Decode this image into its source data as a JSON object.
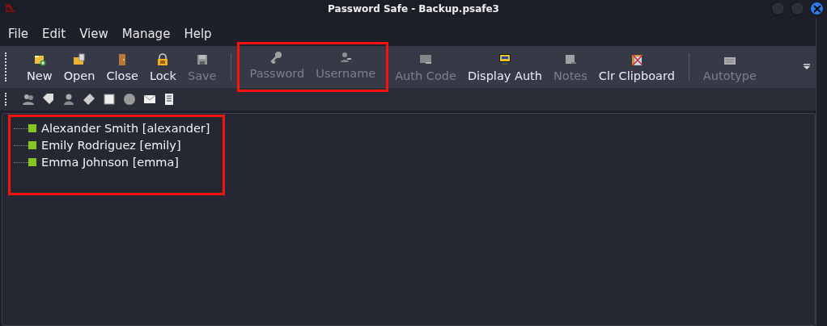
{
  "window": {
    "title": "Password Safe - Backup.psafe3"
  },
  "menu": [
    "File",
    "Edit",
    "View",
    "Manage",
    "Help"
  ],
  "toolbar": [
    {
      "highlighted": false,
      "separator_before": false,
      "buttons": [
        {
          "label": "New",
          "disabled": false
        },
        {
          "label": "Open",
          "disabled": false
        },
        {
          "label": "Close",
          "disabled": false
        },
        {
          "label": "Lock",
          "disabled": false
        },
        {
          "label": "Save",
          "disabled": true
        }
      ]
    },
    {
      "highlighted": true,
      "separator_before": true,
      "buttons": [
        {
          "label": "Password",
          "disabled": true
        },
        {
          "label": "Username",
          "disabled": true
        }
      ]
    },
    {
      "highlighted": false,
      "separator_before": false,
      "buttons": [
        {
          "label": "Auth Code",
          "disabled": true
        },
        {
          "label": "Display Auth",
          "disabled": false
        },
        {
          "label": "Notes",
          "disabled": true
        },
        {
          "label": "Clr Clipboard",
          "disabled": false
        }
      ]
    },
    {
      "highlighted": false,
      "separator_before": true,
      "buttons": [
        {
          "label": "Autotype",
          "disabled": true
        }
      ]
    }
  ],
  "tree": {
    "highlighted": true,
    "items": [
      {
        "label": "Alexander Smith [alexander]"
      },
      {
        "label": "Emily Rodriguez [emily]"
      },
      {
        "label": "Emma Johnson [emma]"
      }
    ]
  }
}
